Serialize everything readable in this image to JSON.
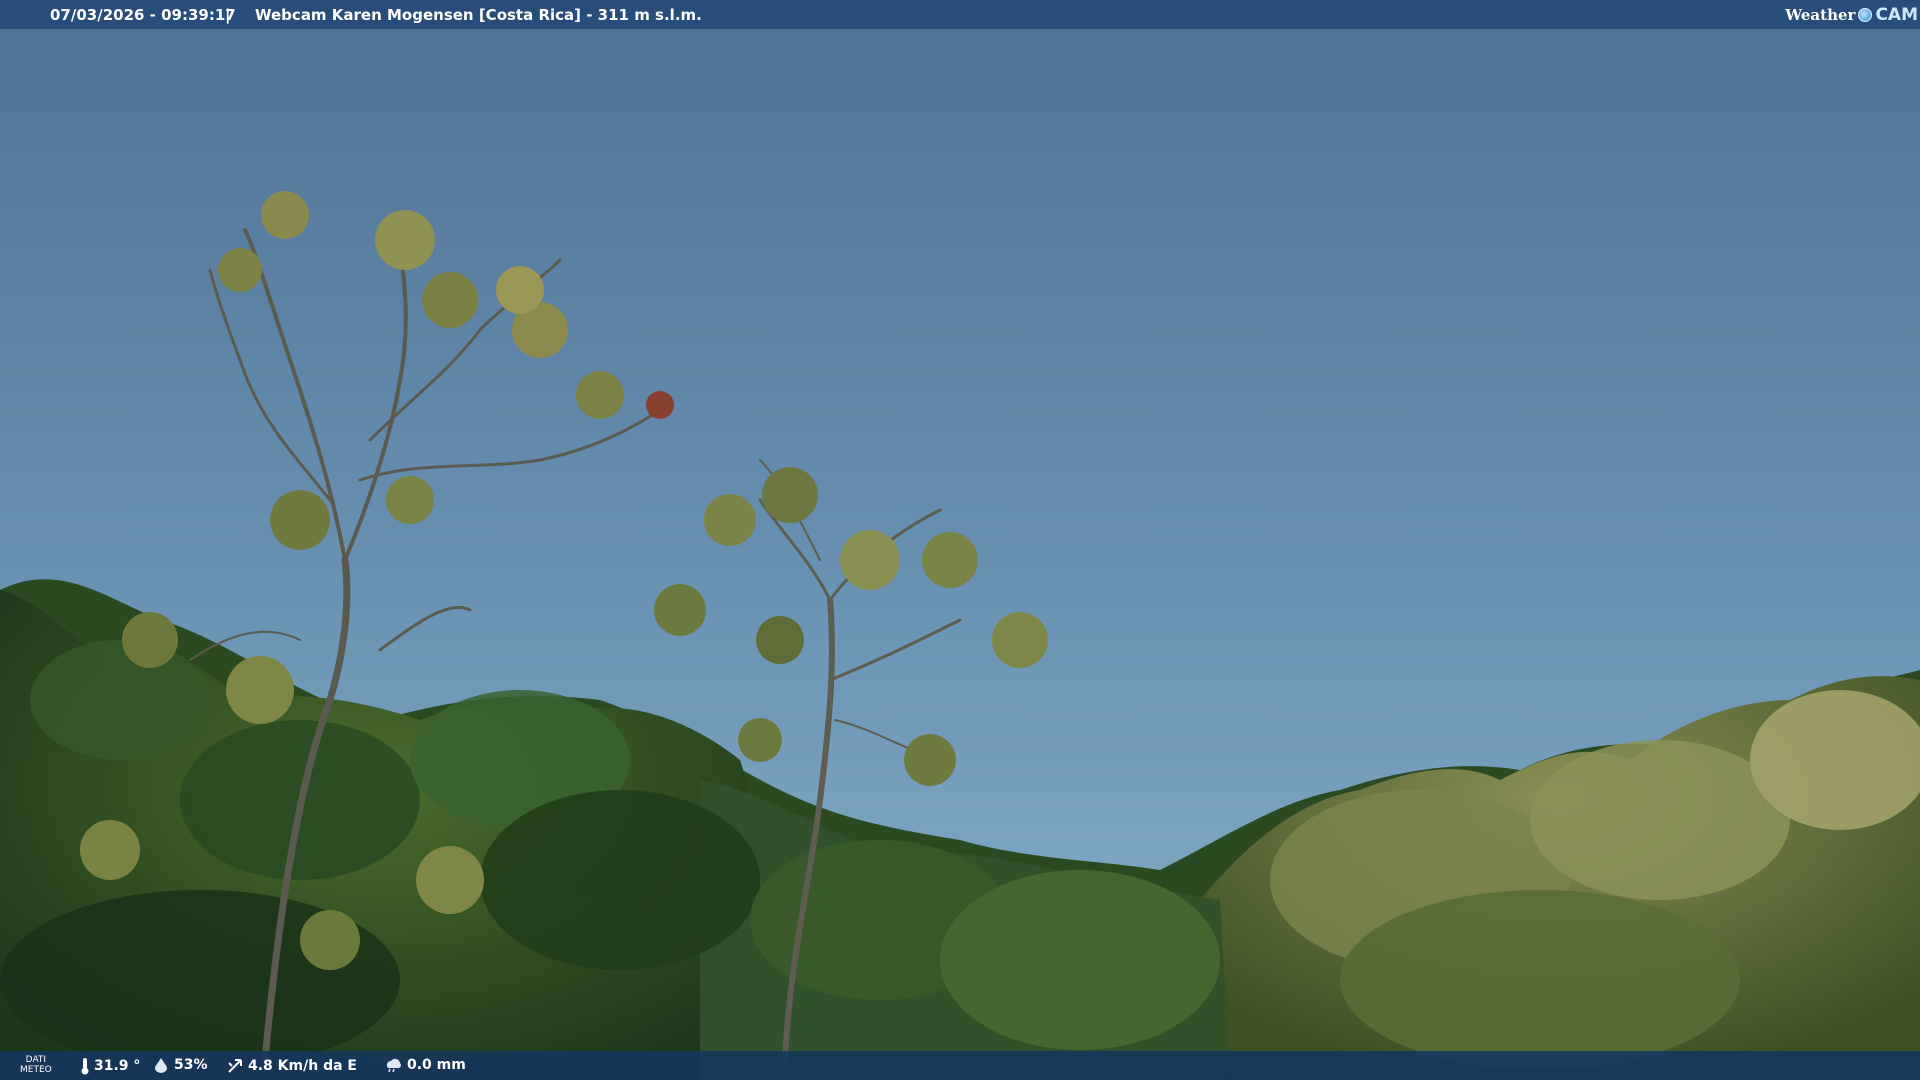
{
  "overlay": {
    "timestamp": "07/03/2026 - 09:39:17",
    "separator": "|",
    "title": "Webcam Karen Mogensen [Costa Rica] - 311 m s.l.m.",
    "logo_left": "Weather",
    "logo_right": "CAM"
  },
  "meteo": {
    "label_line1": "DATI",
    "label_line2": "METEO",
    "temperature": "31.9 °",
    "humidity": "53%",
    "wind": "4.8 Km/h da E",
    "rain": "0.0 mm",
    "icons": [
      "thermometer-icon",
      "humidity-icon",
      "wind-icon",
      "rain-icon"
    ]
  },
  "colors": {
    "sky_top": "#4f7193",
    "sky_bottom": "#85aec8",
    "foliage_dark": "#1e3b1e",
    "foliage_light": "#9ba46a",
    "bar": "#264a78"
  }
}
